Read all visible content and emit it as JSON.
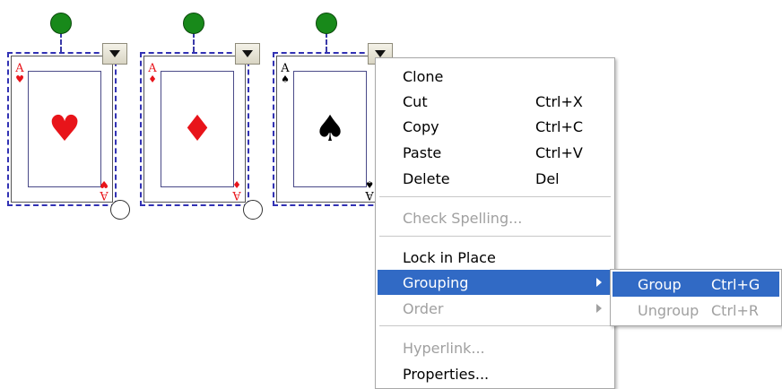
{
  "cards": [
    {
      "rank": "A",
      "suit": "♥",
      "color": "#e8141a"
    },
    {
      "rank": "A",
      "suit": "♦",
      "color": "#e8141a"
    },
    {
      "rank": "A",
      "suit": "♠",
      "color": "#000000"
    }
  ],
  "context_menu": {
    "items": [
      {
        "label": "Clone",
        "shortcut": ""
      },
      {
        "label": "Cut",
        "shortcut": "Ctrl+X"
      },
      {
        "label": "Copy",
        "shortcut": "Ctrl+C"
      },
      {
        "label": "Paste",
        "shortcut": "Ctrl+V"
      },
      {
        "label": "Delete",
        "shortcut": "Del"
      },
      {
        "label": "Check Spelling...",
        "shortcut": ""
      },
      {
        "label": "Lock in Place",
        "shortcut": ""
      },
      {
        "label": "Grouping",
        "shortcut": ""
      },
      {
        "label": "Order",
        "shortcut": ""
      },
      {
        "label": "Hyperlink...",
        "shortcut": ""
      },
      {
        "label": "Properties...",
        "shortcut": ""
      }
    ]
  },
  "grouping_submenu": {
    "items": [
      {
        "label": "Group",
        "shortcut": "Ctrl+G"
      },
      {
        "label": "Ungroup",
        "shortcut": "Ctrl+R"
      }
    ]
  },
  "colors": {
    "highlight": "#316ac5",
    "rotate_handle": "#18891a",
    "selection_border": "#3232b4",
    "red_suit": "#e8141a"
  }
}
